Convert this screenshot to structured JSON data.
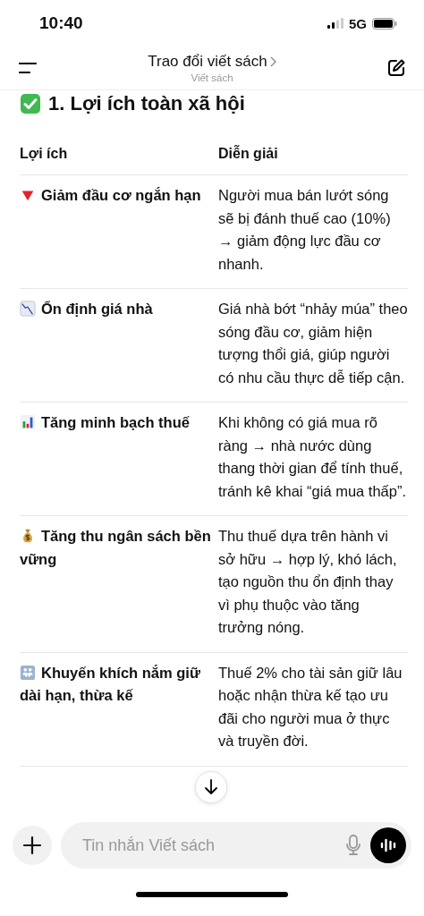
{
  "status_bar": {
    "time": "10:40",
    "network": "5G"
  },
  "header": {
    "title": "Trao đổi viết sách",
    "subtitle": "Viết sách"
  },
  "section": {
    "title": "1. Lợi ích toàn xã hội"
  },
  "table": {
    "columns": [
      "Lợi ích",
      "Diễn giải"
    ],
    "rows": [
      {
        "kind": "down-triangle",
        "benefit": "Giảm đầu cơ ngắn hạn",
        "explanation": "Người mua bán lướt sóng sẽ bị đánh thuế cao (10%) → giảm động lực đầu cơ nhanh."
      },
      {
        "kind": "chart-down",
        "benefit": "Ổn định giá nhà",
        "explanation": "Giá nhà bớt “nhảy múa” theo sóng đầu cơ, giảm hiện tượng thổi giá, giúp người có nhu cầu thực dễ tiếp cận."
      },
      {
        "kind": "bar-chart",
        "benefit": "Tăng minh bạch thuế",
        "explanation": "Khi không có giá mua rõ ràng → nhà nước dùng thang thời gian để tính thuế, tránh kê khai “giá mua thấp”."
      },
      {
        "kind": "money-bag",
        "benefit": "Tăng thu ngân sách bền vững",
        "explanation": "Thu thuế dựa trên hành vi sở hữu → hợp lý, khó lách, tạo nguồn thu ổn định thay vì phụ thuộc vào tăng trưởng nóng."
      },
      {
        "kind": "family",
        "benefit": "Khuyến khích nắm giữ dài hạn, thừa kế",
        "explanation": "Thuế 2% cho tài sản giữ lâu hoặc nhận thừa kế tạo ưu đãi cho người mua ở thực và truyền đời."
      }
    ]
  },
  "composer": {
    "placeholder": "Tin nhắn Viết sách"
  }
}
